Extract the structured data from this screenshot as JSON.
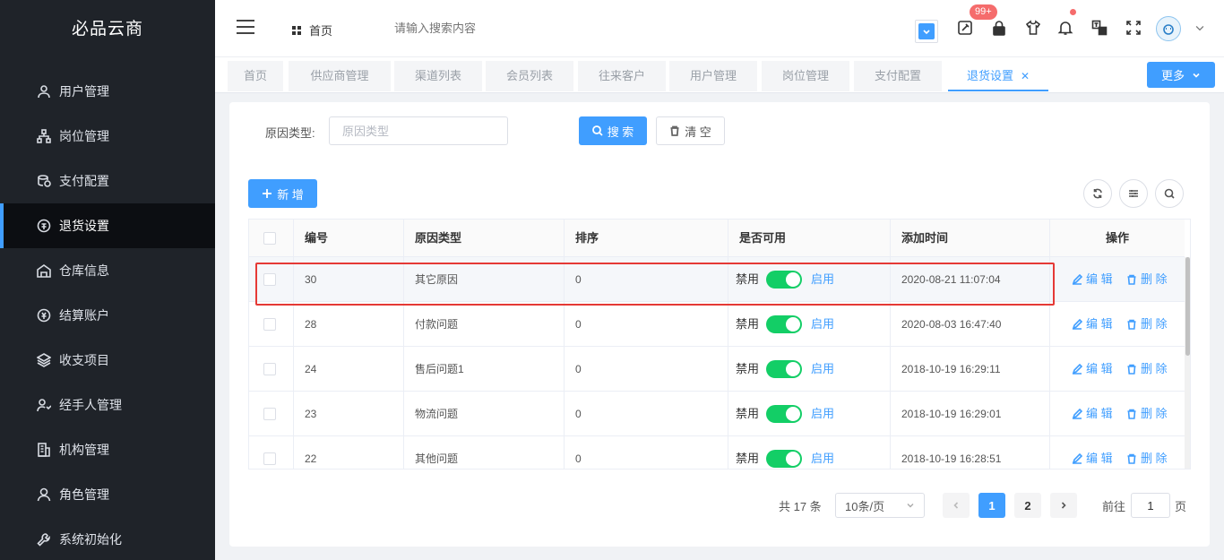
{
  "app": {
    "brand": "必品云商"
  },
  "sidebar": {
    "items": [
      {
        "label": "用户管理",
        "icon": "user-icon"
      },
      {
        "label": "岗位管理",
        "icon": "org-chart-icon"
      },
      {
        "label": "支付配置",
        "icon": "coins-icon"
      },
      {
        "label": "退货设置",
        "icon": "return-icon",
        "active": true
      },
      {
        "label": "仓库信息",
        "icon": "warehouse-icon"
      },
      {
        "label": "结算账户",
        "icon": "account-icon"
      },
      {
        "label": "收支项目",
        "icon": "layers-icon"
      },
      {
        "label": "经手人管理",
        "icon": "handler-icon"
      },
      {
        "label": "机构管理",
        "icon": "building-icon"
      },
      {
        "label": "角色管理",
        "icon": "role-icon"
      },
      {
        "label": "系统初始化",
        "icon": "wrench-icon"
      }
    ]
  },
  "header": {
    "home": "首页",
    "search_placeholder": "请输入搜索内容",
    "badge": "99+"
  },
  "tabs": [
    {
      "label": "首页"
    },
    {
      "label": "供应商管理"
    },
    {
      "label": "渠道列表"
    },
    {
      "label": "会员列表"
    },
    {
      "label": "往来客户"
    },
    {
      "label": "用户管理"
    },
    {
      "label": "岗位管理"
    },
    {
      "label": "支付配置"
    },
    {
      "label": "退货设置",
      "active": true
    }
  ],
  "tabs_more": "更多",
  "filter": {
    "label": "原因类型:",
    "placeholder": "原因类型",
    "search": "搜 索",
    "clear": "清 空",
    "add": "新 增"
  },
  "table": {
    "headers": [
      "编号",
      "原因类型",
      "排序",
      "是否可用",
      "添加时间",
      "操作"
    ],
    "switch_off": "禁用",
    "switch_on": "启用",
    "edit": "编 辑",
    "delete": "删 除",
    "rows": [
      {
        "id": "30",
        "reason": "其它原因",
        "sort": "0",
        "enabled": true,
        "time": "2020-08-21 11:07:04"
      },
      {
        "id": "28",
        "reason": "付款问题",
        "sort": "0",
        "enabled": true,
        "time": "2020-08-03 16:47:40"
      },
      {
        "id": "24",
        "reason": "售后问题1",
        "sort": "0",
        "enabled": true,
        "time": "2018-10-19 16:29:11"
      },
      {
        "id": "23",
        "reason": "物流问题",
        "sort": "0",
        "enabled": true,
        "time": "2018-10-19 16:29:01"
      },
      {
        "id": "22",
        "reason": "其他问题",
        "sort": "0",
        "enabled": true,
        "time": "2018-10-19 16:28:51"
      }
    ]
  },
  "pagination": {
    "total": "共 17 条",
    "page_size": "10条/页",
    "pages": [
      "1",
      "2"
    ],
    "current": "1",
    "goto_label": "前往",
    "goto_value": "1",
    "goto_suffix": "页"
  },
  "colors": {
    "primary": "#409eff",
    "sidebar_bg": "#1f2329",
    "switch_on": "#13ce66",
    "highlight": "#e53935"
  }
}
